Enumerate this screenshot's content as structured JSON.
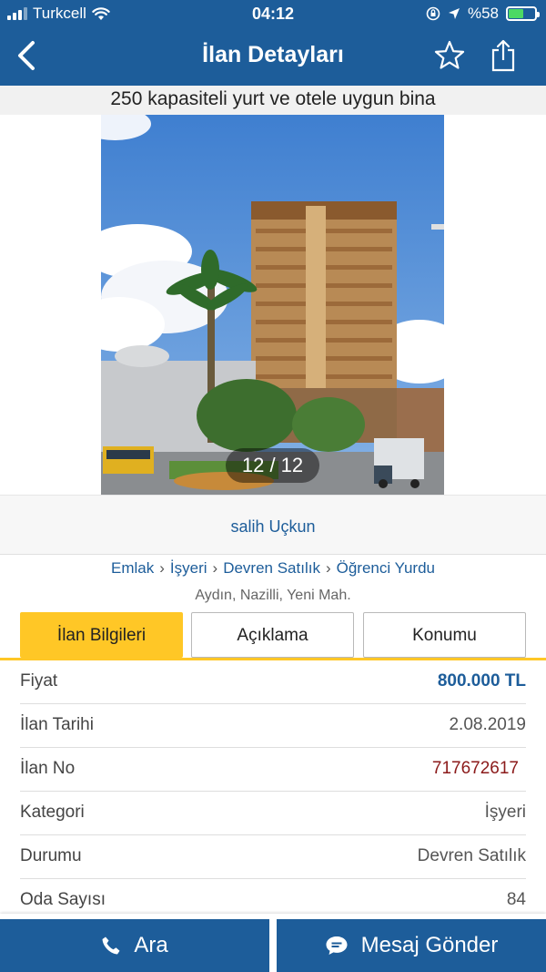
{
  "status_bar": {
    "carrier": "Turkcell",
    "time": "04:12",
    "battery": "%58",
    "battery_level": 0.58
  },
  "nav": {
    "title": "İlan Detayları",
    "back_icon": "chevron-left-icon",
    "favorite_icon": "star-outline-icon",
    "share_icon": "share-icon"
  },
  "listing": {
    "title": "250 kapasiteli yurt ve otele uygun bina",
    "photo_counter": "12 / 12",
    "seller": "salih Uçkun",
    "breadcrumb": [
      "Emlak",
      "İşyeri",
      "Devren Satılık",
      "Öğrenci Yurdu"
    ],
    "breadcrumb_separator": "›",
    "location": "Aydın, Nazilli, Yeni Mah."
  },
  "tabs": [
    {
      "label": "İlan Bilgileri",
      "active": true
    },
    {
      "label": "Açıklama",
      "active": false
    },
    {
      "label": "Konumu",
      "active": false
    }
  ],
  "details": {
    "price": {
      "label": "Fiyat",
      "value": "800.000 TL"
    },
    "date": {
      "label": "İlan Tarihi",
      "value": "2.08.2019"
    },
    "ad_no": {
      "label": "İlan No",
      "value": "717672617"
    },
    "category": {
      "label": "Kategori",
      "value": "İşyeri"
    },
    "status": {
      "label": "Durumu",
      "value": "Devren Satılık"
    },
    "rooms": {
      "label": "Oda Sayısı",
      "value": "84"
    }
  },
  "actions": {
    "call": "Ara",
    "message": "Mesaj Gönder"
  },
  "colors": {
    "primary": "#1d5d9a",
    "accent": "#ffc726",
    "ad_no": "#8b1a1a"
  }
}
